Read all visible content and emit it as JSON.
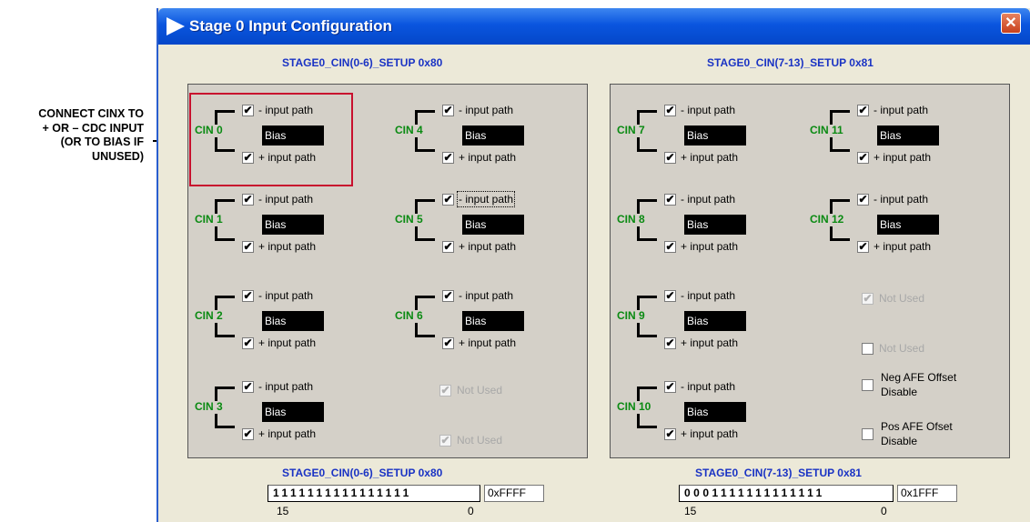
{
  "callout": {
    "lines": [
      "CONNECT CINX TO",
      "+ OR – CDC INPUT",
      "(OR TO BIAS IF",
      "UNUSED)"
    ]
  },
  "window": {
    "title": "Stage 0 Input Configuration",
    "close_glyph": "✕",
    "icon": "play-arrow-icon"
  },
  "left_panel": {
    "header": "STAGE0_CIN(0-6)_SETUP 0x80",
    "cins": [
      {
        "label": "CIN 0",
        "top": "- input path",
        "top_checked": true,
        "bottom": "+ input path",
        "bottom_checked": true,
        "bias": "Bias"
      },
      {
        "label": "CIN 4",
        "top": "- input path",
        "top_checked": true,
        "bottom": "+ input path",
        "bottom_checked": true,
        "bias": "Bias"
      },
      {
        "label": "CIN 1",
        "top": "- input path",
        "top_checked": true,
        "bottom": "+ input path",
        "bottom_checked": true,
        "bias": "Bias"
      },
      {
        "label": "CIN 5",
        "top": "- input path",
        "top_checked": true,
        "bottom": "+ input path",
        "bottom_checked": true,
        "bias": "Bias"
      },
      {
        "label": "CIN 2",
        "top": "- input path",
        "top_checked": true,
        "bottom": "+ input path",
        "bottom_checked": true,
        "bias": "Bias"
      },
      {
        "label": "CIN 6",
        "top": "- input path",
        "top_checked": true,
        "bottom": "+ input path",
        "bottom_checked": true,
        "bias": "Bias"
      },
      {
        "label": "CIN 3",
        "top": "- input path",
        "top_checked": true,
        "bottom": "+ input path",
        "bottom_checked": true,
        "bias": "Bias"
      }
    ],
    "not_used": [
      "Not Used",
      "Not Used"
    ]
  },
  "right_panel": {
    "header": "STAGE0_CIN(7-13)_SETUP 0x81",
    "cins": [
      {
        "label": "CIN 7",
        "top": "- input path",
        "top_checked": true,
        "bottom": "+ input path",
        "bottom_checked": true,
        "bias": "Bias"
      },
      {
        "label": "CIN 11",
        "top": "- input path",
        "top_checked": true,
        "bottom": "+ input path",
        "bottom_checked": true,
        "bias": "Bias"
      },
      {
        "label": "CIN 8",
        "top": "- input path",
        "top_checked": true,
        "bottom": "+ input path",
        "bottom_checked": true,
        "bias": "Bias"
      },
      {
        "label": "CIN 12",
        "top": "- input path",
        "top_checked": true,
        "bottom": "+ input path",
        "bottom_checked": true,
        "bias": "Bias"
      },
      {
        "label": "CIN 9",
        "top": "- input path",
        "top_checked": true,
        "bottom": "+ input path",
        "bottom_checked": true,
        "bias": "Bias"
      },
      {
        "label": "CIN 10",
        "top": "- input path",
        "top_checked": true,
        "bottom": "+ input path",
        "bottom_checked": true,
        "bias": "Bias"
      }
    ],
    "not_used": [
      "Not Used",
      "Not Used"
    ],
    "neg_afe": {
      "line1": "Neg AFE Offset",
      "line2": "Disable",
      "checked": false
    },
    "pos_afe": {
      "line1": "Pos AFE Ofset",
      "line2": "Disable",
      "checked": false
    }
  },
  "registers": [
    {
      "header": "STAGE0_CIN(0-6)_SETUP 0x80",
      "bits": "1111111111111111",
      "value": "0xFFFF",
      "msb": "15",
      "lsb": "0"
    },
    {
      "header": "STAGE0_CIN(7-13)_SETUP 0x81",
      "bits": "0001111111111111",
      "value": "0x1FFF",
      "msb": "15",
      "lsb": "0"
    }
  ],
  "check_glyph": "✔",
  "colors": {
    "title_bar": "#0a55df",
    "header_text": "#1a33c4",
    "cin_label": "#0a8a12",
    "highlight_box": "#c8102e",
    "panel_bg": "#d4d0c8",
    "window_bg": "#ece9d8"
  }
}
